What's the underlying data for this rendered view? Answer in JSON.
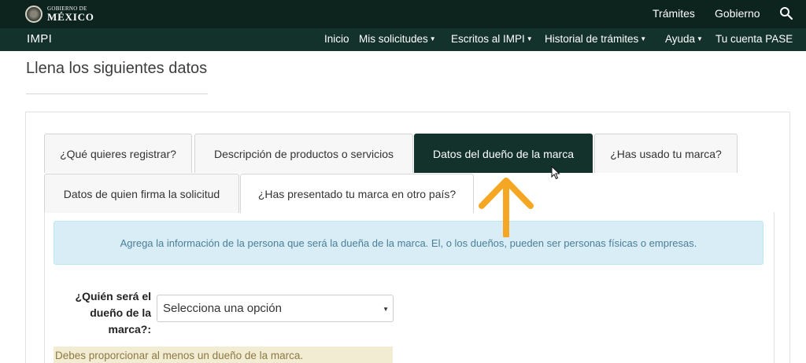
{
  "header": {
    "logo_small": "GOBIERNO DE",
    "logo_big": "MÉXICO",
    "links": [
      "Trámites",
      "Gobierno"
    ]
  },
  "nav": {
    "brand": "IMPI",
    "items": [
      {
        "label": "Inicio"
      },
      {
        "label": "Mis solicitudes"
      },
      {
        "label": "Escritos al IMPI"
      },
      {
        "label": "Historial de trámites"
      },
      {
        "label": "Ayuda"
      },
      {
        "label": "Tu cuenta PASE"
      }
    ]
  },
  "page": {
    "title": "Llena los siguientes datos"
  },
  "tabs": [
    {
      "label": "¿Qué quieres registrar?"
    },
    {
      "label": "Descripción de productos o servicios"
    },
    {
      "label": "Datos del dueño de la marca",
      "active": true
    },
    {
      "label": "¿Has usado tu marca?"
    },
    {
      "label": "Datos de quien firma la solicitud"
    },
    {
      "label": "¿Has presentado tu marca en otro país?"
    }
  ],
  "form": {
    "info_text": "Agrega la información de la persona que será la dueña de la marca. El, o los dueños, pueden ser personas físicas o empresas.",
    "owner_label": "¿Quién será el dueño de la marca?:",
    "owner_select_value": "Selecciona una opción",
    "warning_text": "Debes proporcionar al menos un dueño de la marca."
  },
  "colors": {
    "header_bg": "#0c231e",
    "nav_bg": "#13322b",
    "active_tab": "#13322b",
    "info_bg": "#d9edf7",
    "warning_bg": "#f2ecd2",
    "arrow": "#f5a623"
  }
}
